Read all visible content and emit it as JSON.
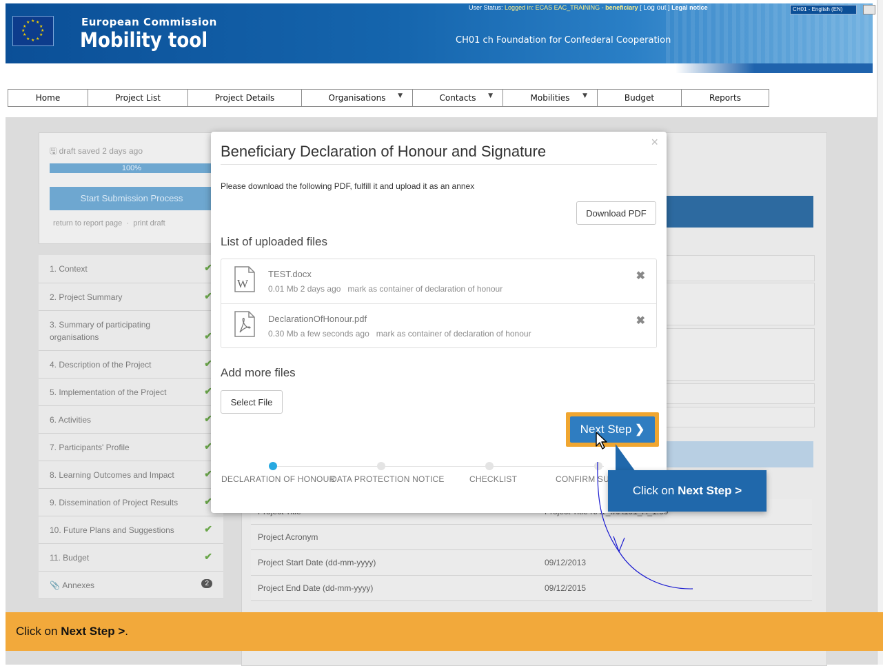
{
  "header": {
    "agency": "European Commission",
    "app_title": "Mobility tool",
    "organisation": "CH01 ch Foundation for Confederal Cooperation",
    "user_status_label": "User Status:",
    "user_status_value": "Logged in: ECAS EAC_TRAINING - ",
    "user_role": "beneficiary",
    "bracket_open": "[",
    "logout_label": "Log out",
    "bracket_close": "]",
    "legal_notice": "Legal notice",
    "language": "CH01 - English (EN)"
  },
  "nav": {
    "items": [
      "Home",
      "Project List",
      "Project Details",
      "Organisations",
      "Contacts",
      "Mobilities",
      "Budget",
      "Reports"
    ]
  },
  "background": {
    "draft_status": "draft saved 2 days ago",
    "progress_value": 100,
    "progress_label": "100%",
    "start_submission": "Start Submission Process",
    "return_link": "return to report page",
    "sep_dot": "·",
    "print_link": "print draft",
    "sections": [
      "1. Context",
      "2. Project Summary",
      "3. Summary of participating organisations",
      "4. Description of the Project",
      "5. Implementation of the Project",
      "6. Activities",
      "7. Participants' Profile",
      "8. Learning Outcomes and Impact",
      "9. Dissemination of Project Results",
      "10. Future Plans and Suggestions",
      "11. Budget",
      "Annexes"
    ],
    "annex_count": "2",
    "info_rows": [
      {
        "label": "Project Title",
        "value": "Project Title KA1_IXA101_A_1.00"
      },
      {
        "label": "Project Acronym",
        "value": ""
      },
      {
        "label": "Project Start Date (dd-mm-yyyy)",
        "value": "09/12/2013"
      },
      {
        "label": "Project End Date (dd-mm-yyyy)",
        "value": "09/12/2015"
      }
    ]
  },
  "modal": {
    "title": "Beneficiary Declaration of Honour and Signature",
    "close": "×",
    "instruction": "Please download the following PDF, fulfill it and upload it as an annex",
    "download_button": "Download PDF",
    "uploaded_heading": "List of uploaded files",
    "files": [
      {
        "name": "TEST.docx",
        "size": "0.01 Mb",
        "age": "2 days ago",
        "action": "mark as container of declaration of honour",
        "icon": "word-file-icon"
      },
      {
        "name": "DeclarationOfHonour.pdf",
        "size": "0.30 Mb",
        "age": "a few seconds ago",
        "action": "mark as container of declaration of honour",
        "icon": "pdf-file-icon"
      }
    ],
    "delete_glyph": "✖",
    "add_heading": "Add more files",
    "select_button": "Select File",
    "next_button": "Next Step",
    "next_glyph": "❯",
    "steps": [
      "DECLARATION OF HONOUR",
      "DATA PROTECTION NOTICE",
      "CHECKLIST",
      "CONFIRM SU"
    ]
  },
  "callout": {
    "prefix": "Click on ",
    "bold": "Next Step >"
  },
  "instruction_bar": {
    "prefix": "Click on ",
    "bold": "Next Step >",
    "suffix": "."
  },
  "colors": {
    "accent": "#2f7dc1",
    "highlight": "#f0a630",
    "banner": "#0b4f97"
  }
}
